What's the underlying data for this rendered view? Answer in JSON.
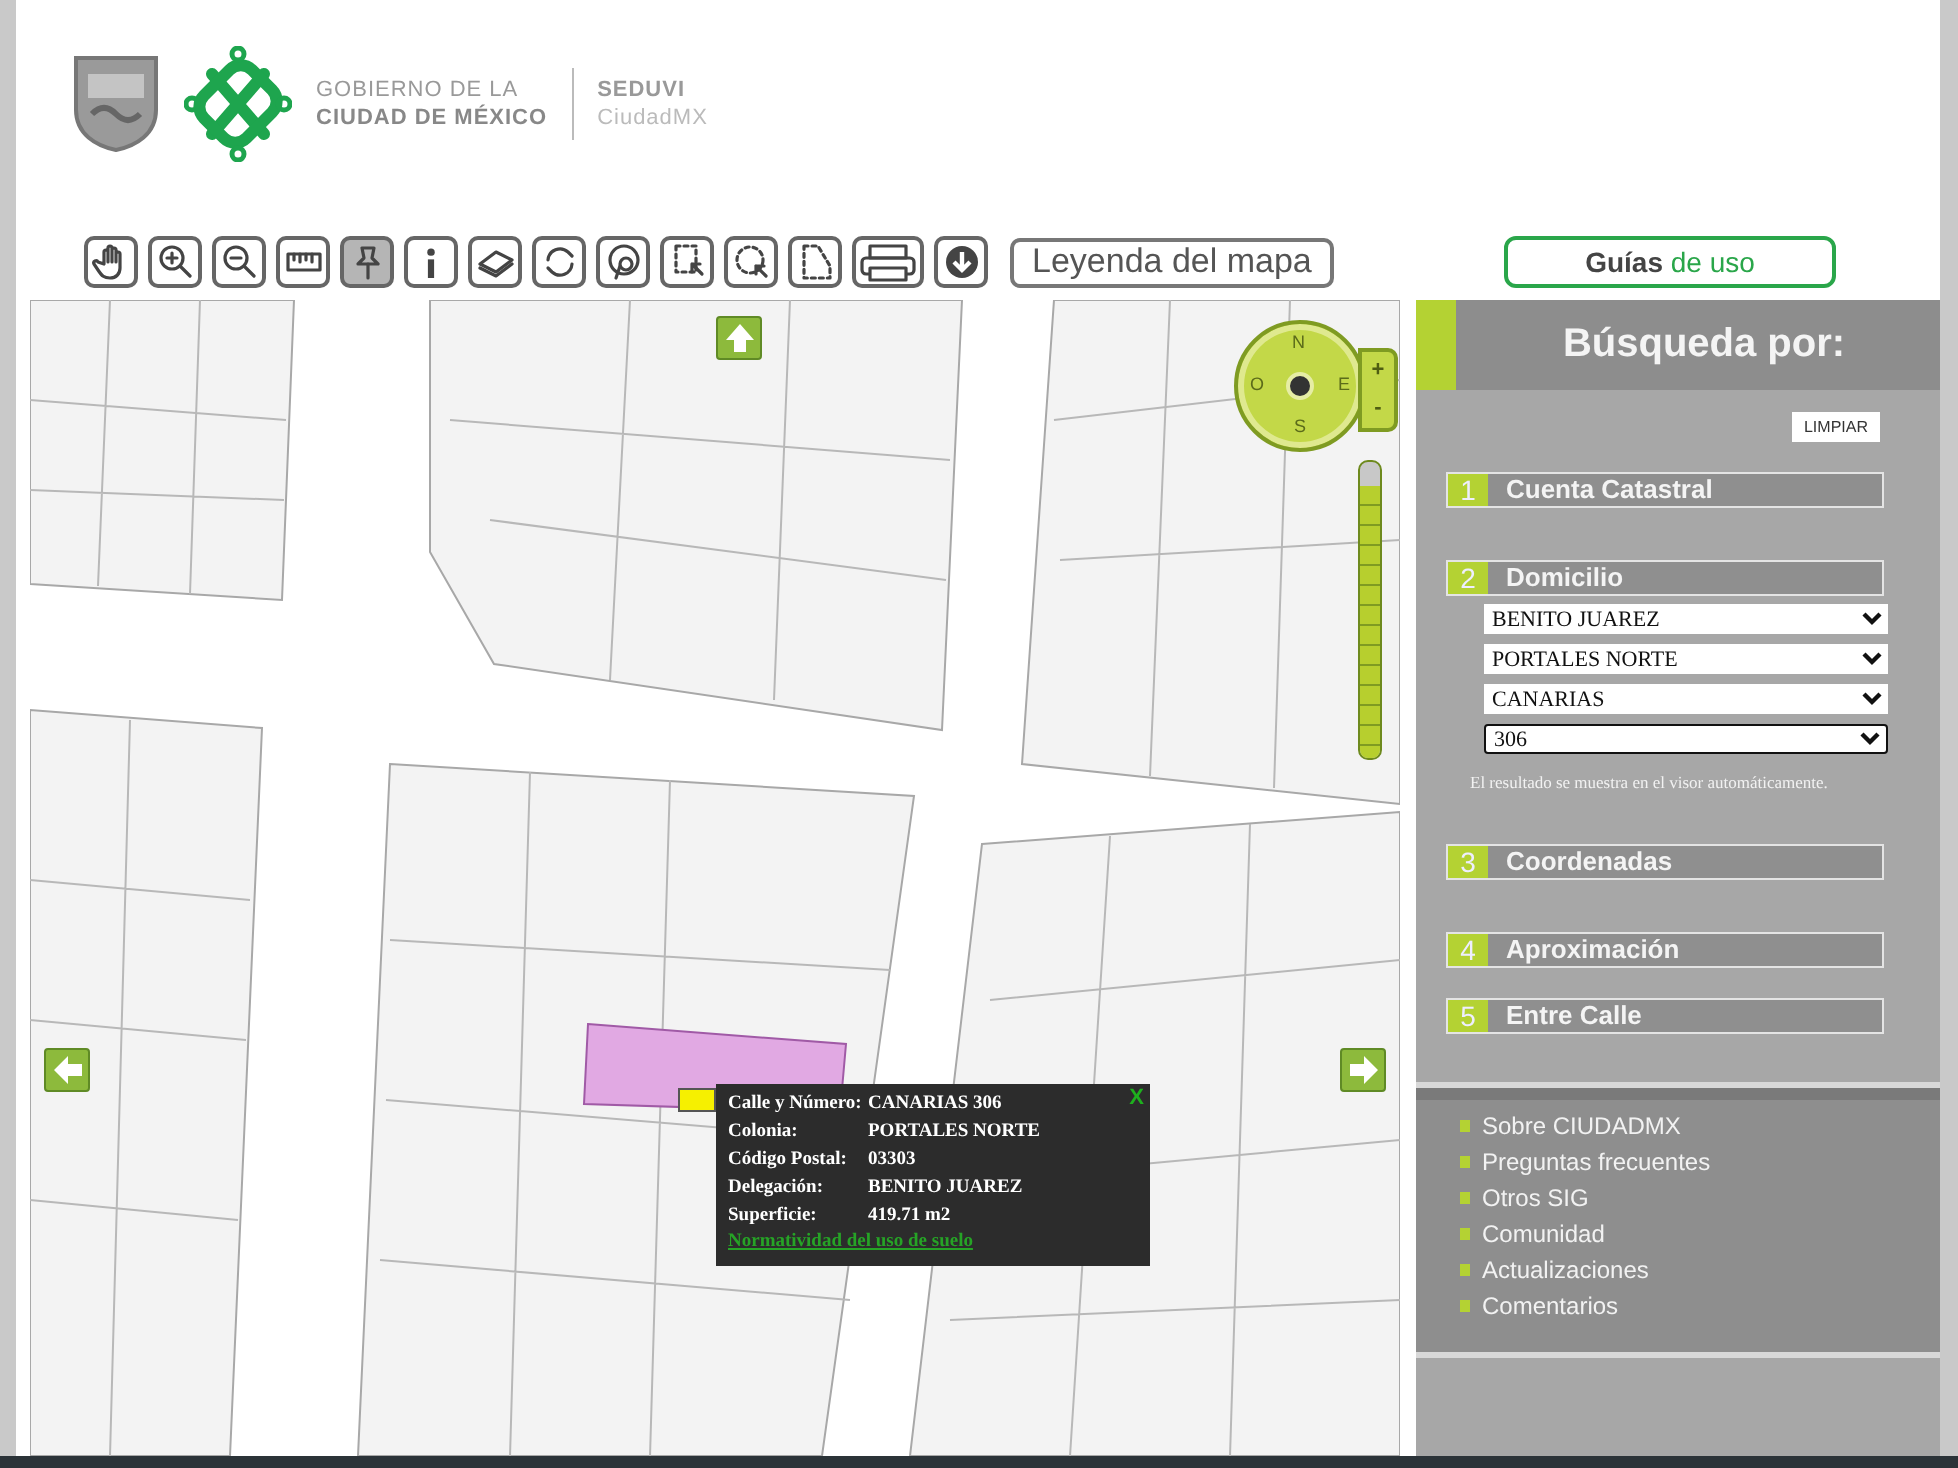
{
  "header": {
    "gov_line1": "GOBIERNO DE LA",
    "gov_line2": "CIUDAD DE MÉXICO",
    "agency": "SEDUVI",
    "app": "CiudadMX"
  },
  "toolbar": {
    "tools": [
      {
        "selected": false
      },
      {
        "selected": false
      },
      {
        "selected": false
      },
      {
        "selected": false
      },
      {
        "selected": true
      },
      {
        "selected": false
      },
      {
        "selected": false
      },
      {
        "selected": false
      },
      {
        "selected": false
      },
      {
        "selected": false
      },
      {
        "selected": false
      },
      {
        "selected": false
      },
      {
        "selected": false
      },
      {
        "selected": false
      }
    ],
    "legend_button": "Leyenda del mapa"
  },
  "guide_button": {
    "text": "Guías",
    "accent": "de uso"
  },
  "map": {
    "kind": "picture",
    "compass": {
      "north": "N",
      "west": "O",
      "east": "E",
      "south": "S"
    },
    "zoom": {
      "plus": "+",
      "minus": "-",
      "level": 0.92
    },
    "popup": {
      "close": "X",
      "fields": [
        {
          "label": "Calle y Número:",
          "value": "CANARIAS 306"
        },
        {
          "label": "Colonia:",
          "value": "PORTALES NORTE"
        },
        {
          "label": "Código Postal:",
          "value": "03303"
        },
        {
          "label": "Delegación:",
          "value": "BENITO JUAREZ"
        },
        {
          "label": "Superficie:",
          "value": "419.71 m2"
        }
      ],
      "link": "Normatividad del uso de suelo"
    }
  },
  "search": {
    "title": "Búsqueda por:",
    "clear_button": "LIMPIAR",
    "sections": [
      {
        "number": "1",
        "label": "Cuenta Catastral"
      },
      {
        "number": "2",
        "label": "Domicilio",
        "dropdowns": [
          {
            "value": "BENITO JUAREZ",
            "focused": false
          },
          {
            "value": "PORTALES NORTE",
            "focused": false
          },
          {
            "value": "CANARIAS",
            "focused": false
          },
          {
            "value": "306",
            "focused": true
          }
        ],
        "note": "El resultado se muestra en el visor automáticamente."
      },
      {
        "number": "3",
        "label": "Coordenadas"
      },
      {
        "number": "4",
        "label": "Aproximación"
      },
      {
        "number": "5",
        "label": "Entre Calle"
      }
    ]
  },
  "links": [
    "Sobre CIUDADMX",
    "Preguntas frecuentes",
    "Otros SIG",
    "Comunidad",
    "Actualizaciones",
    "Comentarios"
  ]
}
